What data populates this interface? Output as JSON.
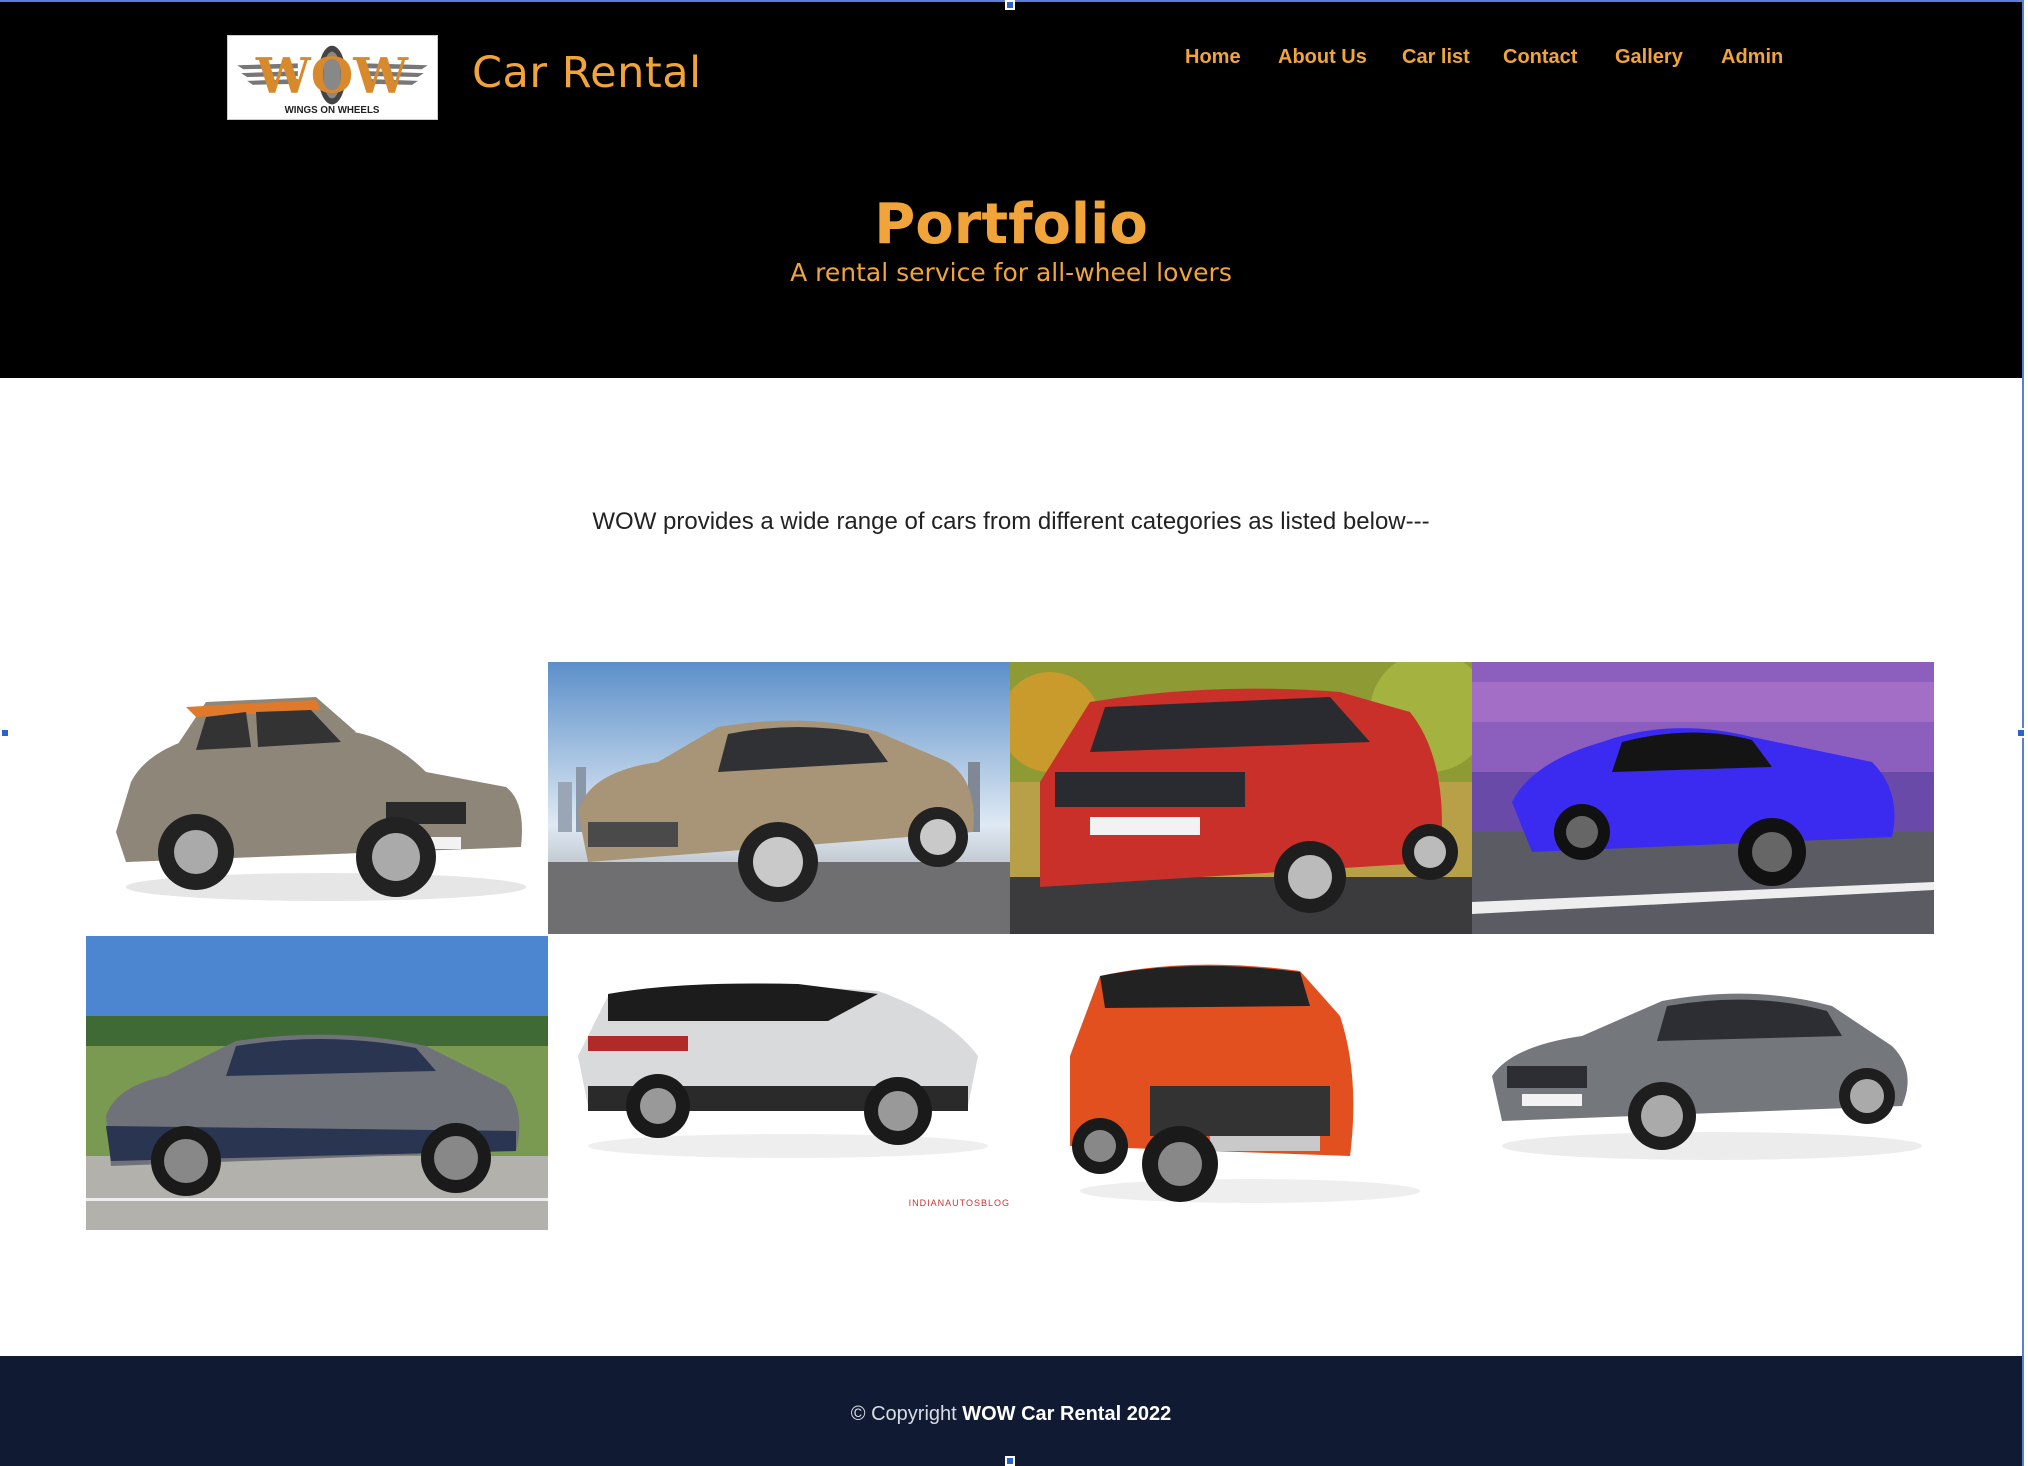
{
  "header": {
    "logo": {
      "wordmark": "WOW",
      "tagline": "WINGS ON WHEELS"
    },
    "brand_title": "Car Rental",
    "nav": [
      "Home",
      "About Us",
      "Car list",
      "Contact",
      "Gallery",
      "Admin"
    ]
  },
  "hero": {
    "title": "Portfolio",
    "subtitle": "A rental service for all-wheel lovers"
  },
  "intro": "WOW provides a wide range of cars from different categories as listed below---",
  "gallery": {
    "cars": [
      {
        "body": "suv",
        "color": "#8e8678",
        "accent": "#e07a2a",
        "bg": "#ffffff"
      },
      {
        "body": "sedan",
        "color": "#a89476",
        "accent": "#a89476",
        "bg": "sky-city"
      },
      {
        "body": "suv",
        "color": "#c9302a",
        "accent": "#c9302a",
        "bg": "autumn"
      },
      {
        "body": "coupe",
        "color": "#3b2bf0",
        "accent": "#3b2bf0",
        "bg": "purple-motion"
      },
      {
        "body": "coupe-suv",
        "color": "#6f7278",
        "accent": "#2a3552",
        "bg": "field"
      },
      {
        "body": "suv",
        "color": "#d9dadc",
        "accent": "#1c1c1c",
        "bg": "#ffffff"
      },
      {
        "body": "suv",
        "color": "#e2501f",
        "accent": "#222",
        "bg": "#ffffff"
      },
      {
        "body": "sedan",
        "color": "#74777c",
        "accent": "#74777c",
        "bg": "#ffffff"
      }
    ],
    "watermark": "INDIANAUTOSBLOG"
  },
  "footer": {
    "prefix": "© Copyright ",
    "brand": "WOW Car Rental 2022"
  }
}
